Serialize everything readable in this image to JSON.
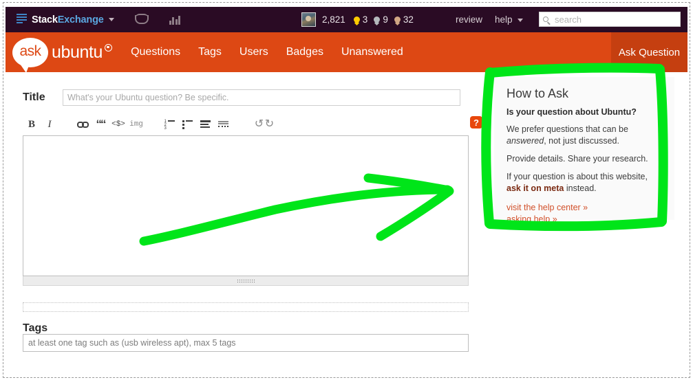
{
  "topbar": {
    "stacks_icon": "stacks-icon",
    "network_label_1": "Stack",
    "network_label_2": "Exchange",
    "inbox_icon": "inbox-icon",
    "achievements_icon": "achievements-icon",
    "avatar": "user-avatar",
    "reputation": "2,821",
    "badges": [
      {
        "type": "gold",
        "count": "3",
        "color": "#ffcc01"
      },
      {
        "type": "silver",
        "count": "9",
        "color": "#b4b8bc"
      },
      {
        "type": "bronze",
        "count": "32",
        "color": "#d1a684"
      }
    ],
    "review_label": "review",
    "help_label": "help",
    "search_placeholder": "search",
    "search_value": "",
    "search_icon": "search-icon",
    "background": "#2a0b24"
  },
  "header": {
    "logo_bubble_text": "ask",
    "logo_word": "ubuntu",
    "nav": [
      {
        "label": "Questions"
      },
      {
        "label": "Tags"
      },
      {
        "label": "Users"
      },
      {
        "label": "Badges"
      },
      {
        "label": "Unanswered"
      }
    ],
    "ask_question_label": "Ask Question",
    "background": "#dd4814",
    "ask_button_background": "#c53f10"
  },
  "form": {
    "title_label": "Title",
    "title_placeholder": "What's your Ubuntu question? Be specific.",
    "title_value": "",
    "body_value": "",
    "tags_label": "Tags",
    "tags_placeholder": "at least one tag such as (usb wireless apt), max 5 tags",
    "tags_value": "",
    "toolbar": [
      {
        "name": "bold-button",
        "label": "B"
      },
      {
        "name": "italic-button",
        "label": "I"
      },
      {
        "name": "link-button",
        "label": ""
      },
      {
        "name": "blockquote-button",
        "label": "\""
      },
      {
        "name": "code-button",
        "label": "<$>"
      },
      {
        "name": "image-button",
        "label": "img"
      },
      {
        "name": "numbered-list-button",
        "label": ""
      },
      {
        "name": "bulleted-list-button",
        "label": ""
      },
      {
        "name": "heading-button",
        "label": ""
      },
      {
        "name": "horizontal-rule-button",
        "label": ""
      },
      {
        "name": "undo-button",
        "label": "↺"
      },
      {
        "name": "redo-button",
        "label": "↻"
      }
    ],
    "help_icon_label": "?",
    "help_icon_color": "#e8470c"
  },
  "sidebar": {
    "heading": "How to Ask",
    "subheading": "Is your question about Ubuntu?",
    "p1_a": "We prefer questions that can be ",
    "p1_em": "answered",
    "p1_b": ", not just discussed.",
    "p2": "Provide details. Share your research.",
    "p3_a": "If your question is about this website, ",
    "p3_link": "ask it on meta",
    "p3_b": " instead.",
    "link1": "visit the help center »",
    "link2": "asking help »",
    "link_color": "#d1502a",
    "background": "#fafafa"
  },
  "annotations": {
    "color": "#00e519",
    "arrow_name": "green-arrow-annotation",
    "box_name": "green-box-annotation"
  }
}
